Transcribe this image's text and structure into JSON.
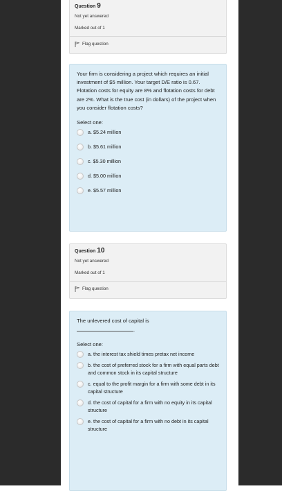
{
  "q9": {
    "title_prefix": "Question ",
    "number": "9",
    "status": "Not yet answered",
    "marked": "Marked out of 1",
    "flag": "Flag question",
    "text": "Your firm is considering a project which requires an initial investment of $5 million. Your target D/E ratio is 0.67. Flotation costs for equity are 8% and flotation costs for debt are 2%. What is the true cost (in dollars) of the project when you consider flotation costs?",
    "select_label": "Select one:",
    "options": [
      "a. $5.24 million",
      "b. $5.61 million",
      "c. $5.30 million",
      "d. $5.00 million",
      "e. $5.57 million"
    ]
  },
  "q10": {
    "title_prefix": "Question ",
    "number": "10",
    "status": "Not yet answered",
    "marked": "Marked out of 1",
    "flag": "Flag question",
    "text": "The unlevered cost of capital is",
    "text_end": ".",
    "select_label": "Select one:",
    "options": [
      "a. the interest tax shield times pretax net income",
      "b. the cost of preferred stock for a firm with equal parts debt and common stock in its capital structure",
      "c. equal to the profit margin for a firm with some debt in its capital structure",
      "d. the cost of capital for a firm with no equity in its capital structure",
      "e. the cost of capital for a firm with no debt in its capital structure"
    ]
  }
}
